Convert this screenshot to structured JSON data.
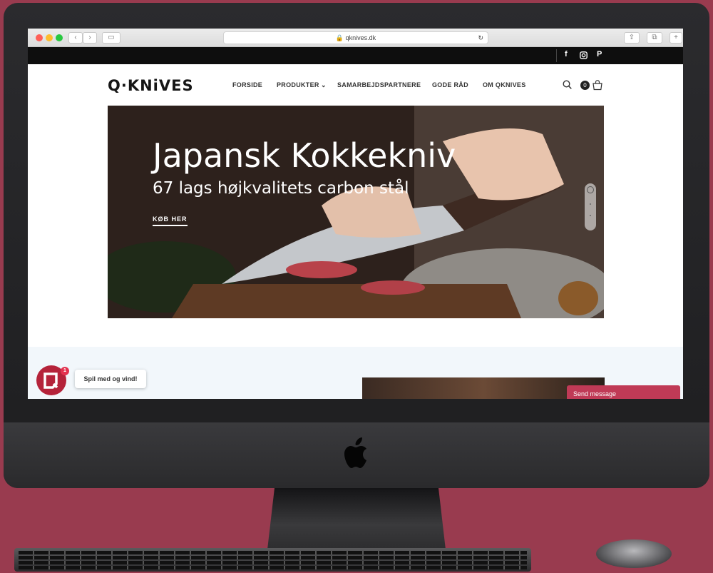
{
  "browser": {
    "url": "qknives.dk"
  },
  "social": {
    "facebook": "f",
    "instagram": "instagram-icon",
    "pinterest": "P"
  },
  "header": {
    "logo_text": "Q·KNiVES",
    "cart_count": "0",
    "nav": [
      {
        "label": "FORSIDE"
      },
      {
        "label": "PRODUKTER"
      },
      {
        "label": "SAMARBEJDSPARTNERE"
      },
      {
        "label": "GODE RÅD"
      },
      {
        "label": "OM QKNIVES"
      }
    ]
  },
  "hero": {
    "title": "Japansk Kokkekniv",
    "subtitle": "67 lags højkvalitets carbon stål",
    "cta": "KØB HER"
  },
  "widgets": {
    "game_badge": "1",
    "game_tooltip": "Spil med og vind!",
    "send_message": "Send message"
  },
  "colors": {
    "background": "#993b4f",
    "accent": "#b5233a",
    "topbar": "#0e0e0e"
  }
}
